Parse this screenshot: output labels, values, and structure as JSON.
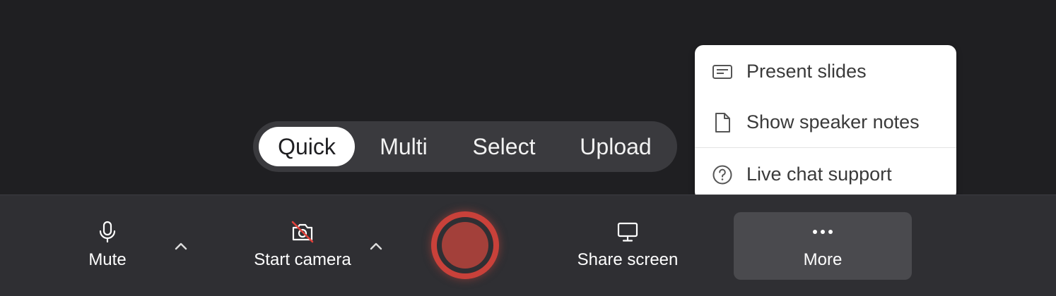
{
  "mode_switch": {
    "options": [
      {
        "label": "Quick",
        "active": true
      },
      {
        "label": "Multi",
        "active": false
      },
      {
        "label": "Select",
        "active": false
      },
      {
        "label": "Upload",
        "active": false
      }
    ]
  },
  "toolbar": {
    "mute": {
      "label": "Mute",
      "icon": "microphone-icon"
    },
    "camera": {
      "label": "Start camera",
      "icon": "camera-off-icon"
    },
    "record": {
      "icon": "record-icon",
      "color": "#c9413a"
    },
    "share": {
      "label": "Share screen",
      "icon": "monitor-icon"
    },
    "more": {
      "label": "More",
      "icon": "ellipsis-icon",
      "active": true
    }
  },
  "more_menu": {
    "items": [
      {
        "label": "Present slides",
        "icon": "slides-icon"
      },
      {
        "label": "Show speaker notes",
        "icon": "document-icon"
      },
      {
        "label": "Live chat support",
        "icon": "help-circle-icon"
      }
    ]
  },
  "colors": {
    "background": "#1f1f22",
    "toolbar": "#2f2f33",
    "record_ring": "#c9413a",
    "menu_bg": "#ffffff"
  }
}
